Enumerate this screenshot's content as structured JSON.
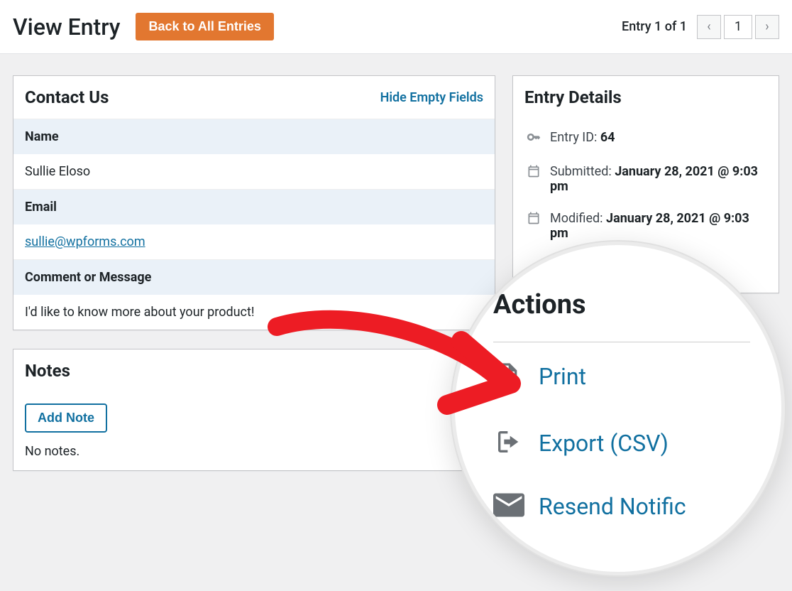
{
  "header": {
    "page_title": "View Entry",
    "back_label": "Back to All Entries",
    "entry_count": "Entry 1 of 1",
    "page_number": "1"
  },
  "form": {
    "title": "Contact Us",
    "hide_empty_label": "Hide Empty Fields",
    "fields": {
      "name_label": "Name",
      "name_value": "Sullie Eloso",
      "email_label": "Email",
      "email_value": "sullie@wpforms.com",
      "comment_label": "Comment or Message",
      "comment_value": "I'd like to know more about your product!"
    }
  },
  "notes": {
    "title": "Notes",
    "add_label": "Add Note",
    "empty_text": "No notes."
  },
  "details": {
    "title": "Entry Details",
    "id_label": "Entry ID: ",
    "id_value": "64",
    "submitted_label": "Submitted: ",
    "submitted_value": "January 28, 2021 @ 9:03 pm",
    "modified_label": "Modified: ",
    "modified_value": "January 28, 2021 @ 9:03 pm"
  },
  "actions": {
    "title": "Actions",
    "print": "Print",
    "export": "Export (CSV)",
    "resend": "Resend Notific"
  }
}
